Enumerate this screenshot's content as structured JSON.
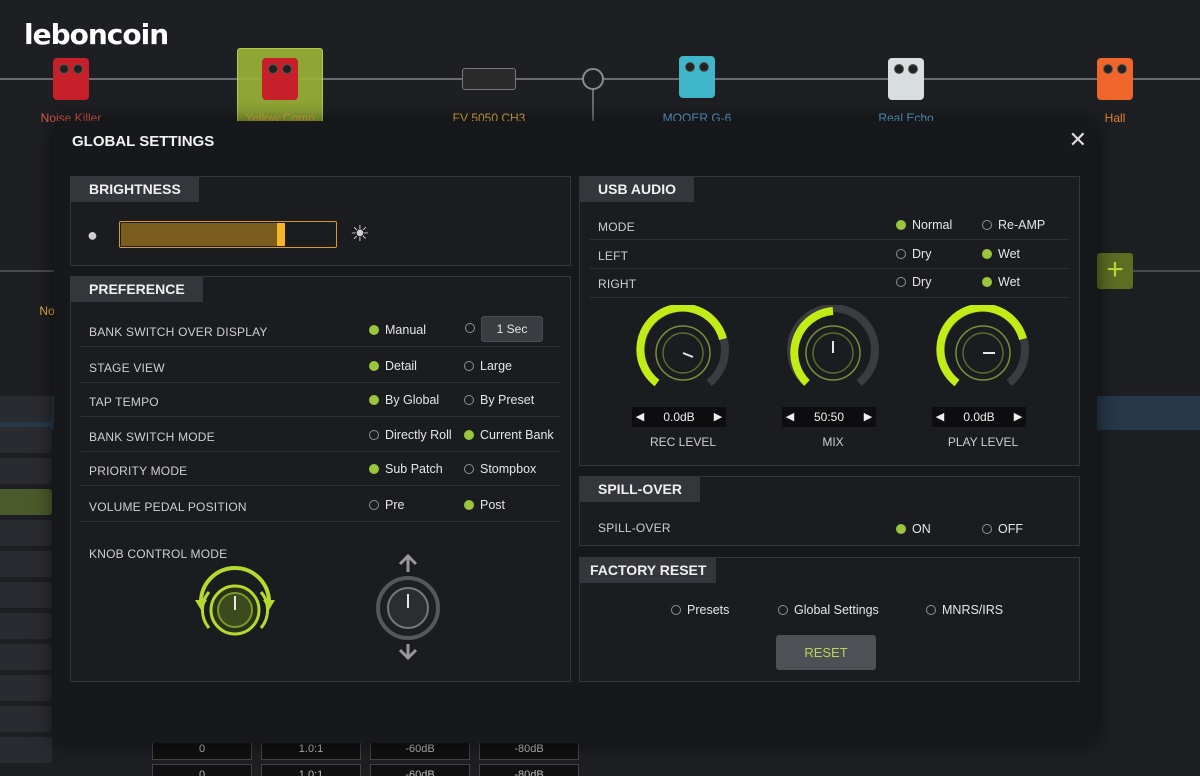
{
  "app": {
    "logo": "leboncoin"
  },
  "chain": {
    "pedals": [
      {
        "label": "Noise Killer",
        "color": "#e05a4a"
      },
      {
        "label": "Yellow Comp",
        "color": "#e0b040"
      },
      {
        "label": "FV 5050 CH3",
        "color": "#e0b040"
      },
      {
        "label": "MOOER G-6",
        "color": "#5aa9d6"
      },
      {
        "label": "Real Echo",
        "color": "#5aa9d6"
      },
      {
        "label": "Hall",
        "color": "#e08030"
      }
    ],
    "row2_label": "No"
  },
  "bottom": {
    "cells_row1": [
      "0",
      "1.0:1",
      "-60dB",
      "-80dB"
    ],
    "cells_row2": [
      "0",
      "1.0:1",
      "-60dB",
      "-80dB"
    ]
  },
  "modal": {
    "title": "GLOBAL SETTINGS",
    "brightness": {
      "header": "BRIGHTNESS",
      "level": 0.75
    },
    "preference": {
      "header": "PREFERENCE",
      "rows": [
        {
          "label": "BANK SWITCH OVER DISPLAY",
          "opt1": "Manual",
          "opt1_on": true,
          "opt2": "1 Sec",
          "opt2_on": false
        },
        {
          "label": "STAGE VIEW",
          "opt1": "Detail",
          "opt1_on": true,
          "opt2": "Large",
          "opt2_on": false
        },
        {
          "label": "TAP TEMPO",
          "opt1": "By Global",
          "opt1_on": true,
          "opt2": "By Preset",
          "opt2_on": false
        },
        {
          "label": "BANK SWITCH MODE",
          "opt1": "Directly Roll",
          "opt1_on": false,
          "opt2": "Current Bank",
          "opt2_on": true
        },
        {
          "label": "PRIORITY MODE",
          "opt1": "Sub Patch",
          "opt1_on": true,
          "opt2": "Stompbox",
          "opt2_on": false
        },
        {
          "label": "VOLUME PEDAL POSITION",
          "opt1": "Pre",
          "opt1_on": false,
          "opt2": "Post",
          "opt2_on": true
        }
      ],
      "knob_mode_label": "KNOB CONTROL MODE"
    },
    "usb": {
      "header": "USB AUDIO",
      "rows": [
        {
          "label": "MODE",
          "opt1": "Normal",
          "opt1_on": true,
          "opt2": "Re-AMP",
          "opt2_on": false
        },
        {
          "label": "LEFT",
          "opt1": "Dry",
          "opt1_on": false,
          "opt2": "Wet",
          "opt2_on": true
        },
        {
          "label": "RIGHT",
          "opt1": "Dry",
          "opt1_on": false,
          "opt2": "Wet",
          "opt2_on": true
        }
      ],
      "knobs": [
        {
          "label": "REC LEVEL",
          "value": "0.0dB"
        },
        {
          "label": "MIX",
          "value": "50:50"
        },
        {
          "label": "PLAY LEVEL",
          "value": "0.0dB"
        }
      ]
    },
    "spill": {
      "header": "SPILL-OVER",
      "label": "SPILL-OVER",
      "opt1": "ON",
      "opt2": "OFF"
    },
    "factory": {
      "header": "FACTORY RESET",
      "options": [
        "Presets",
        "Global Settings",
        "MNRS/IRS"
      ],
      "reset_label": "RESET"
    }
  },
  "colors": {
    "accent": "#9bc53d",
    "bright": "#f5b526"
  }
}
